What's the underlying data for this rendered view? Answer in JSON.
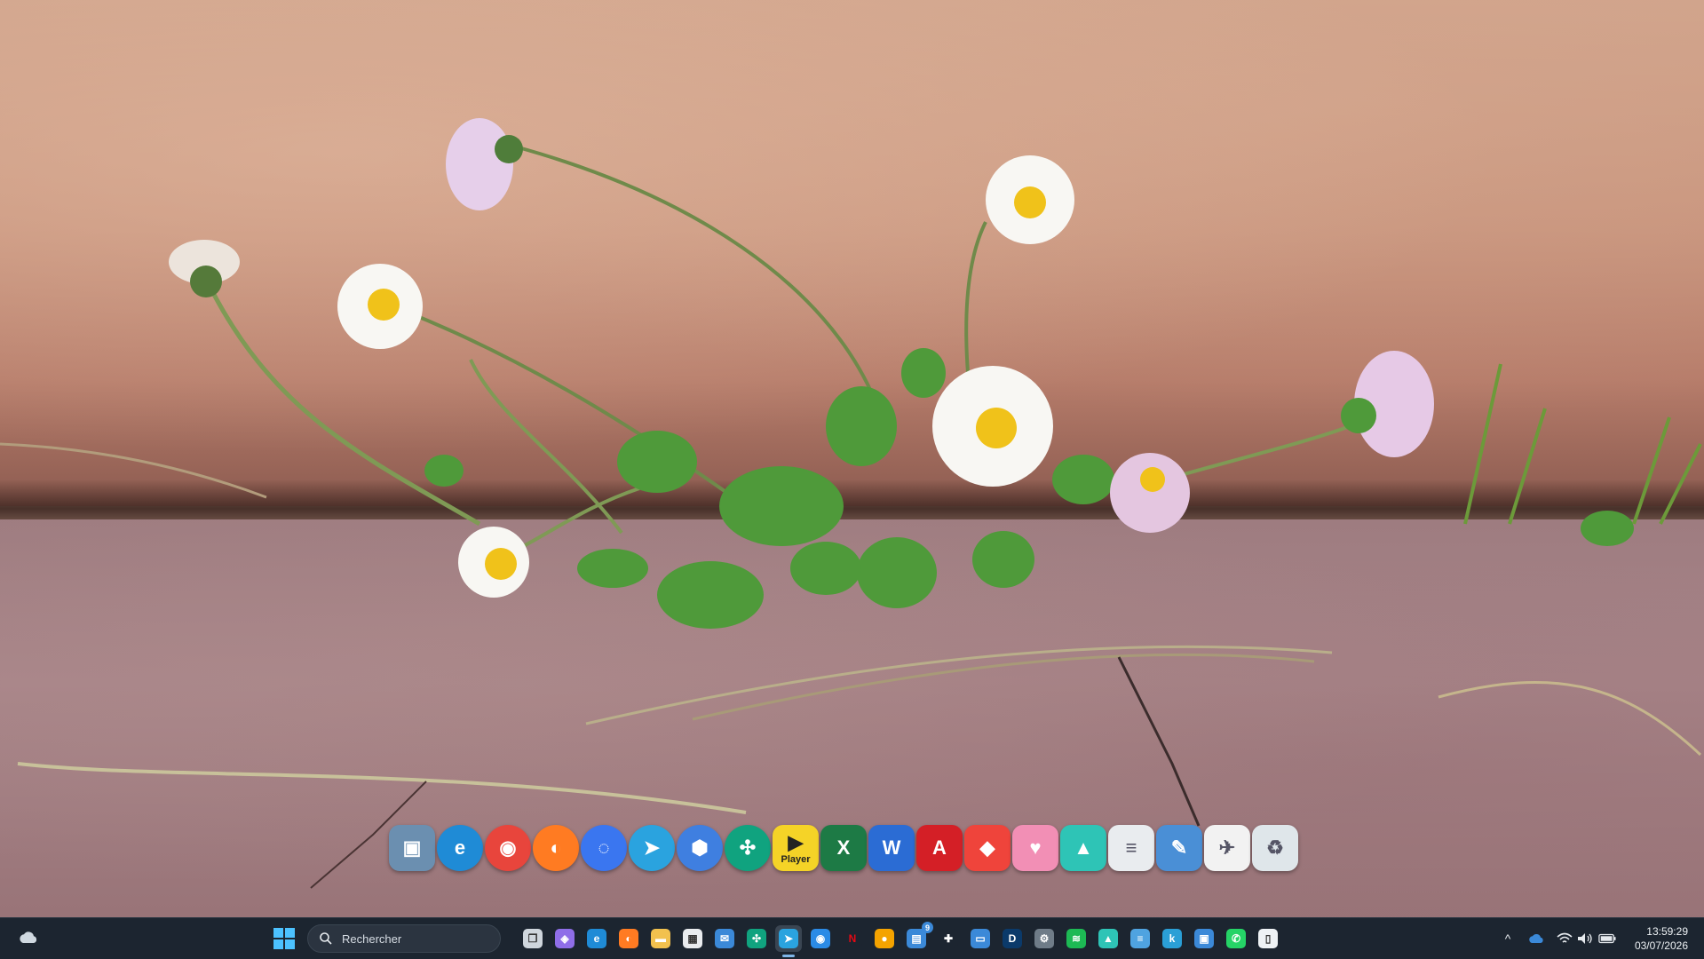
{
  "desktop": {
    "wallpaper_description_colors": {
      "wall": "#c6917a",
      "pavement": "#a88589"
    },
    "dock_icons": [
      {
        "name": "image-viewer-icon",
        "color": "#6b8fb0",
        "glyph": "▣"
      },
      {
        "name": "edge-icon",
        "color": "#1f8bd6",
        "glyph": "e"
      },
      {
        "name": "chrome-icon",
        "color": "#e8453c",
        "glyph": "◉"
      },
      {
        "name": "firefox-icon",
        "color": "#ff7b22",
        "glyph": "◐"
      },
      {
        "name": "signal-icon",
        "color": "#3a76f0",
        "glyph": "◌"
      },
      {
        "name": "telegram-icon",
        "color": "#2aa3df",
        "glyph": "➤"
      },
      {
        "name": "shield-app-icon",
        "color": "#3f7fe0",
        "glyph": "⬢"
      },
      {
        "name": "chatgpt-icon",
        "color": "#10a37f",
        "glyph": "✣"
      },
      {
        "name": "player-icon",
        "color": "#f5d327",
        "glyph": "▶",
        "label": "Player"
      },
      {
        "name": "excel-icon",
        "color": "#1d7a45",
        "glyph": "X"
      },
      {
        "name": "word-icon",
        "color": "#2b6cd4",
        "glyph": "W"
      },
      {
        "name": "acrobat-icon",
        "color": "#d41f26",
        "glyph": "A"
      },
      {
        "name": "anydesk-icon",
        "color": "#ef443b",
        "glyph": "◆"
      },
      {
        "name": "piggy-bank-icon",
        "color": "#f28fb5",
        "glyph": "♥"
      },
      {
        "name": "nordvpn-icon",
        "color": "#2ec4b6",
        "glyph": "▲"
      },
      {
        "name": "notepad-icon",
        "color": "#e9ecef",
        "glyph": "≡"
      },
      {
        "name": "lamp-icon",
        "color": "#4a8fd6",
        "glyph": "✎"
      },
      {
        "name": "paper-plane-icon",
        "color": "#f2f2f2",
        "glyph": "✈"
      },
      {
        "name": "recycle-bin-icon",
        "color": "#dfe6ea",
        "glyph": "♻"
      }
    ]
  },
  "taskbar": {
    "search_placeholder": "Rechercher",
    "apps": [
      {
        "name": "task-view-icon",
        "color": "#cfd6dd",
        "glyph": "❐"
      },
      {
        "name": "copilot-icon",
        "color": "#8f6ee8",
        "glyph": "◈"
      },
      {
        "name": "edge-icon",
        "color": "#1f8bd6",
        "glyph": "e"
      },
      {
        "name": "firefox-icon",
        "color": "#ff7b22",
        "glyph": "◐"
      },
      {
        "name": "file-explorer-icon",
        "color": "#f2c14e",
        "glyph": "▬"
      },
      {
        "name": "store-icon",
        "color": "#e9ecef",
        "glyph": "▦"
      },
      {
        "name": "mail-icon",
        "color": "#3b89d8",
        "glyph": "✉"
      },
      {
        "name": "chatgpt-icon",
        "color": "#10a37f",
        "glyph": "✣"
      },
      {
        "name": "telegram-icon",
        "color": "#2aa3df",
        "glyph": "➤",
        "active": true
      },
      {
        "name": "messenger-icon",
        "color": "#2b8be6",
        "glyph": "◉"
      },
      {
        "name": "netflix-icon",
        "color": "#1c2530",
        "glyph": "N",
        "text_color": "#e50914"
      },
      {
        "name": "color-app-icon",
        "color": "#f4a300",
        "glyph": "●"
      },
      {
        "name": "widget-app-icon",
        "color": "#3b89d8",
        "glyph": "▤",
        "badge": "9"
      },
      {
        "name": "plus-app-icon",
        "color": "#1c2530",
        "glyph": "✚"
      },
      {
        "name": "remote-desktop-icon",
        "color": "#3b89d8",
        "glyph": "▭"
      },
      {
        "name": "disney-plus-icon",
        "color": "#0b3a6a",
        "glyph": "D"
      },
      {
        "name": "settings-icon",
        "color": "#6f7c88",
        "glyph": "⚙"
      },
      {
        "name": "spotify-icon",
        "color": "#1db954",
        "glyph": "≋"
      },
      {
        "name": "nordvpn-icon",
        "color": "#2ec4b6",
        "glyph": "▲"
      },
      {
        "name": "notepad-icon",
        "color": "#4fa3e0",
        "glyph": "≡"
      },
      {
        "name": "k-app-icon",
        "color": "#2a9fd6",
        "glyph": "k"
      },
      {
        "name": "control-panel-icon",
        "color": "#3b89d8",
        "glyph": "▣"
      },
      {
        "name": "whatsapp-icon",
        "color": "#25d366",
        "glyph": "✆"
      },
      {
        "name": "file-icon",
        "color": "#eef2f5",
        "glyph": "▯"
      }
    ],
    "tray": {
      "chevron": "^",
      "icons": [
        "onedrive-icon",
        "wifi-icon",
        "volume-icon",
        "battery-icon"
      ]
    },
    "clock": {
      "time": "13:59:29",
      "date": "03/07/2026"
    }
  }
}
